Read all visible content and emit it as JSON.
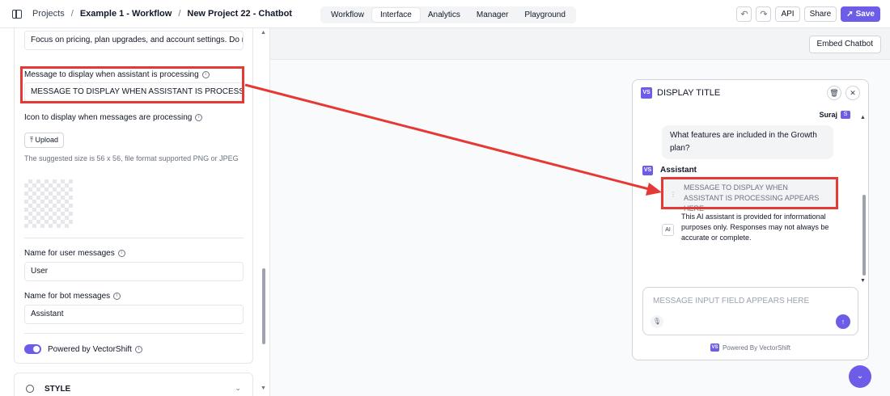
{
  "breadcrumb": {
    "items": [
      "Projects",
      "Example 1 - Workflow",
      "New Project 22 - Chatbot"
    ],
    "separator": "/"
  },
  "nav_tabs": [
    {
      "label": "Workflow",
      "active": false
    },
    {
      "label": "Interface",
      "active": true
    },
    {
      "label": "Analytics",
      "active": false
    },
    {
      "label": "Manager",
      "active": false
    },
    {
      "label": "Playground",
      "active": false
    }
  ],
  "toolbar": {
    "undo_icon": "undo-icon",
    "redo_icon": "redo-icon",
    "api_label": "API",
    "share_label": "Share",
    "save_label": "Save"
  },
  "left_panel": {
    "top_field_value": "Focus on pricing, plan upgrades, and account settings. Do no",
    "processing_message": {
      "label": "Message to display when assistant is processing",
      "value": "MESSAGE TO DISPLAY WHEN ASSISTANT IS PROCESSING A"
    },
    "processing_icon": {
      "label": "Icon to display when messages are processing",
      "upload_label": "Upload",
      "hint": "The suggested size is 56 x 56, file format supported PNG or JPEG"
    },
    "user_messages": {
      "label": "Name for user messages",
      "value": "User"
    },
    "bot_messages": {
      "label": "Name for bot messages",
      "value": "Assistant"
    },
    "powered_toggle": {
      "label": "Powered by VectorShift",
      "enabled": true
    },
    "style_section": {
      "label": "STYLE"
    }
  },
  "preview": {
    "embed_label": "Embed Chatbot",
    "chat": {
      "logo_text": "VS",
      "title": "DISPLAY TITLE",
      "user_name": "Suraj",
      "user_avatar": "S",
      "user_message": "What features are included in the Growth plan?",
      "bot_label": "Assistant",
      "processing_text": "MESSAGE TO DISPLAY WHEN ASSISTANT IS PROCESSING APPEARS HERE",
      "ai_badge": "AI",
      "disclaimer": "This AI assistant is provided for informational purposes only. Responses may not always be accurate or complete.",
      "input_placeholder": "MESSAGE INPUT FIELD APPEARS HERE",
      "powered_by": "Powered By VectorShift"
    }
  },
  "colors": {
    "accent": "#6d5ce8",
    "annotation": "#e53935"
  }
}
